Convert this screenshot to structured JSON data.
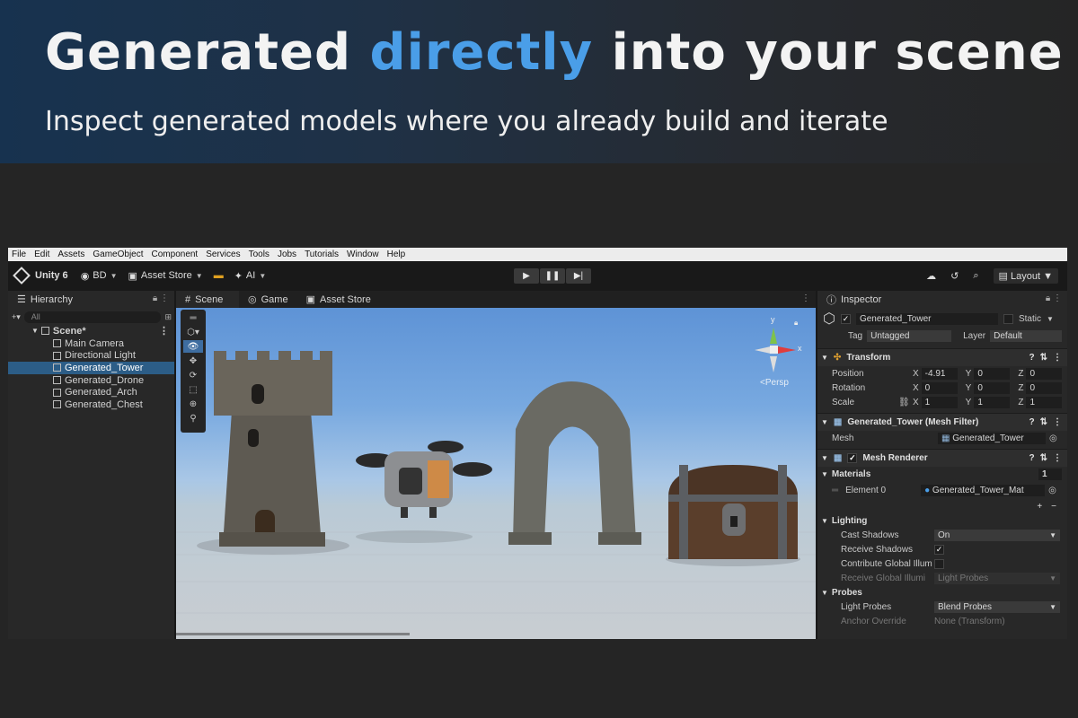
{
  "banner": {
    "headline_pre": "Generated ",
    "headline_accent": "directly",
    "headline_post": " into your scene",
    "subline": "Inspect generated models where you already build and iterate",
    "accent_color": "#4a9ee8"
  },
  "menubar": [
    "File",
    "Edit",
    "Assets",
    "GameObject",
    "Component",
    "Services",
    "Tools",
    "Jobs",
    "Tutorials",
    "Window",
    "Help"
  ],
  "toolbar": {
    "unity_label": "Unity 6",
    "account_label": "BD",
    "asset_store_label": "Asset Store",
    "ai_label": "AI",
    "layout_label": "Layout"
  },
  "hierarchy": {
    "tab_label": "Hierarchy",
    "search_placeholder": "All",
    "scene_label": "Scene*",
    "items": [
      {
        "label": "Main Camera"
      },
      {
        "label": "Directional Light"
      },
      {
        "label": "Generated_Tower"
      },
      {
        "label": "Generated_Drone"
      },
      {
        "label": "Generated_Arch"
      },
      {
        "label": "Generated_Chest"
      }
    ]
  },
  "scene": {
    "tabs": [
      "Scene",
      "Game",
      "Asset Store"
    ],
    "persp_label": "<Persp",
    "gizmo_x": "x",
    "gizmo_y": "y"
  },
  "inspector": {
    "tab_label": "Inspector",
    "object_name": "Generated_Tower",
    "static_label": "Static",
    "tag_label": "Tag",
    "tag_value": "Untagged",
    "layer_label": "Layer",
    "layer_value": "Default",
    "transform": {
      "title": "Transform",
      "position_label": "Position",
      "pos_x": "-4.91",
      "pos_y": "0",
      "pos_z": "0",
      "rotation_label": "Rotation",
      "rot_x": "0",
      "rot_y": "0",
      "rot_z": "0",
      "scale_label": "Scale",
      "scale_x": "1",
      "scale_y": "1",
      "scale_z": "1"
    },
    "mesh_filter": {
      "title": "Generated_Tower (Mesh Filter)",
      "mesh_label": "Mesh",
      "mesh_value": "Generated_Tower"
    },
    "mesh_renderer": {
      "title": "Mesh Renderer",
      "materials_label": "Materials",
      "materials_count": "1",
      "element_label": "Element 0",
      "element_value": "Generated_Tower_Mat",
      "lighting_label": "Lighting",
      "cast_shadows_label": "Cast Shadows",
      "cast_shadows_value": "On",
      "receive_shadows_label": "Receive Shadows",
      "contribute_gi_label": "Contribute Global Illum",
      "receive_gi_label": "Receive Global Illumi",
      "receive_gi_value": "Light Probes",
      "probes_label": "Probes",
      "light_probes_label": "Light Probes",
      "light_probes_value": "Blend Probes",
      "anchor_override_label": "Anchor Override",
      "anchor_override_value": "None (Transform)"
    }
  },
  "axis_labels": [
    "X",
    "Y",
    "Z"
  ]
}
